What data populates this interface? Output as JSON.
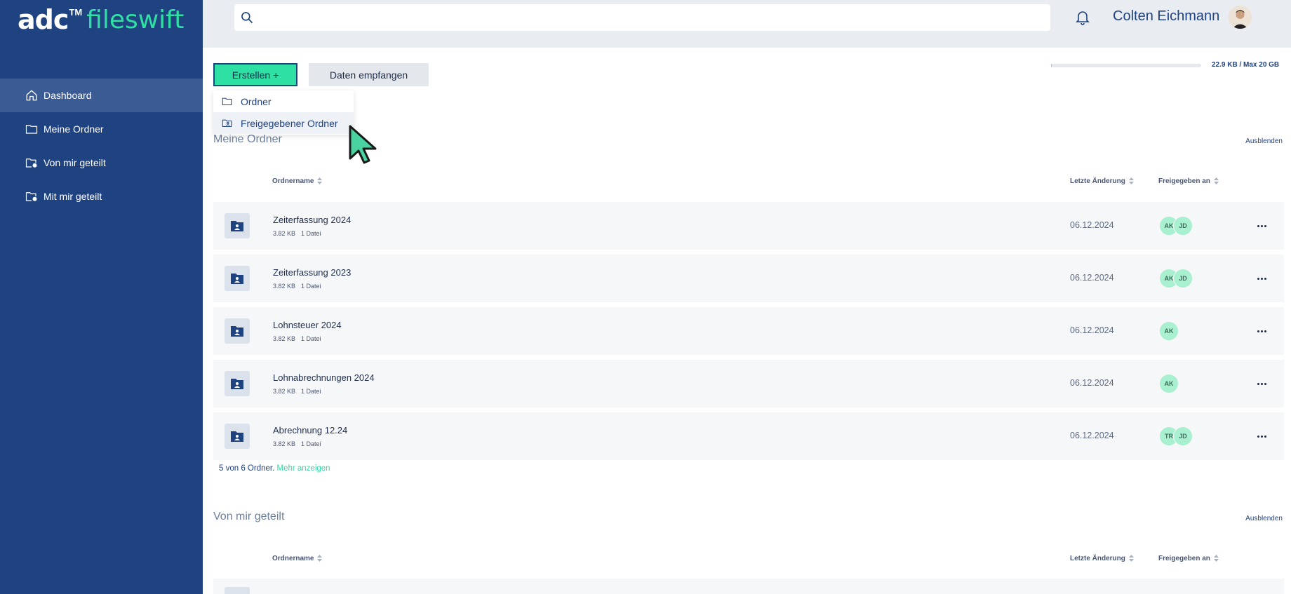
{
  "app": {
    "logo_main": "adc",
    "logo_tm": "TM",
    "logo_product": "fileswift"
  },
  "sidebar": {
    "items": [
      {
        "label": "Dashboard",
        "icon": "home-icon"
      },
      {
        "label": "Meine Ordner",
        "icon": "folder-icon"
      },
      {
        "label": "Von mir geteilt",
        "icon": "shared-folder-out-icon"
      },
      {
        "label": "Mit mir geteilt",
        "icon": "shared-folder-in-icon"
      }
    ]
  },
  "header": {
    "search_value": "",
    "search_placeholder": "",
    "user_name": "Colten Eichmann"
  },
  "toolbar": {
    "create_label": "Erstellen +",
    "receive_label": "Daten empfangen",
    "storage_used": 0.001,
    "storage_text": "22.9 KB / Max 20 GB"
  },
  "create_menu": {
    "items": [
      {
        "label": "Ordner",
        "icon": "folder-icon"
      },
      {
        "label": "Freigegebener Ordner",
        "icon": "shared-folder-icon"
      }
    ]
  },
  "my_folders": {
    "title": "Meine Ordner",
    "hide_label": "Ausblenden",
    "columns": {
      "name": "Ordnername",
      "modified": "Letzte Änderung",
      "shared": "Freigegeben an"
    },
    "rows": [
      {
        "name": "Zeiterfassung 2024",
        "size": "3.82 KB",
        "files": "1 Datei",
        "date": "06.12.2024",
        "shared": [
          "AK",
          "JD"
        ]
      },
      {
        "name": "Zeiterfassung 2023",
        "size": "3.82 KB",
        "files": "1 Datei",
        "date": "06.12.2024",
        "shared": [
          "AK",
          "JD"
        ]
      },
      {
        "name": "Lohnsteuer 2024",
        "size": "3.82 KB",
        "files": "1 Datei",
        "date": "06.12.2024",
        "shared": [
          "AK"
        ]
      },
      {
        "name": "Lohnabrechnungen 2024",
        "size": "3.82 KB",
        "files": "1 Datei",
        "date": "06.12.2024",
        "shared": [
          "AK"
        ]
      },
      {
        "name": "Abrechnung 12.24",
        "size": "3.82 KB",
        "files": "1 Datei",
        "date": "06.12.2024",
        "shared": [
          "TR",
          "JD"
        ]
      }
    ],
    "summary_text": "5 von 6 Ordner.",
    "more_label": "Mehr anzeigen"
  },
  "shared_by_me": {
    "title": "Von mir geteilt",
    "hide_label": "Ausblenden",
    "columns": {
      "name": "Ordnername",
      "modified": "Letzte Änderung",
      "shared": "Freigegeben an"
    }
  }
}
